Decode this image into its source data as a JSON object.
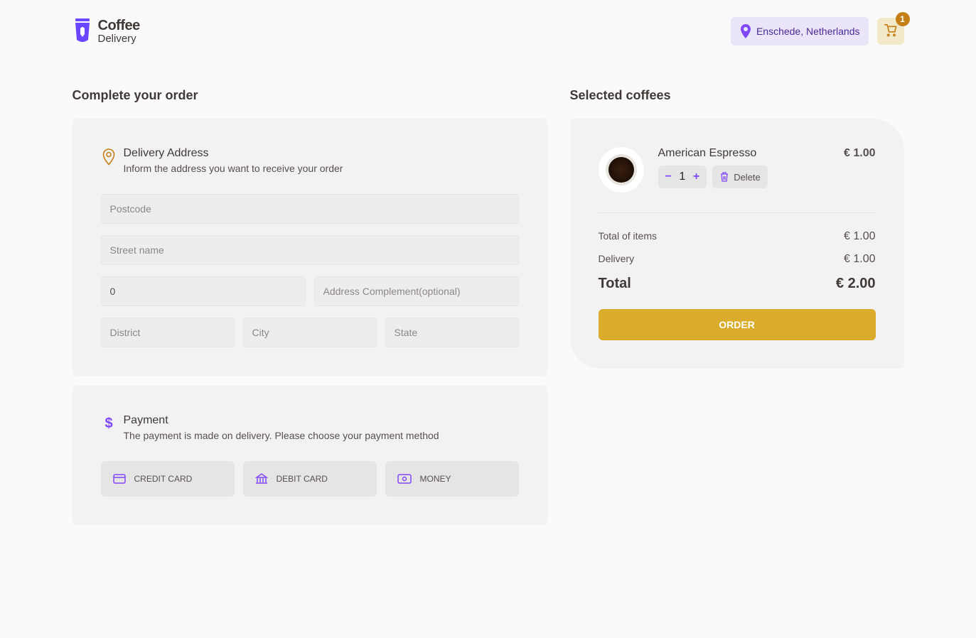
{
  "header": {
    "logo_line1": "Coffee",
    "logo_line2": "Delivery",
    "location": "Enschede, Netherlands",
    "cart_count": "1"
  },
  "checkout": {
    "title": "Complete your order",
    "address_card": {
      "title": "Delivery Address",
      "subtitle": "Inform the address you want to receive your order",
      "postcode_ph": "Postcode",
      "street_ph": "Street name",
      "number_value": "0",
      "complement_ph": "Address Complement(optional)",
      "district_ph": "District",
      "city_ph": "City",
      "state_ph": "State"
    },
    "payment_card": {
      "title": "Payment",
      "subtitle": "The payment is made on delivery. Please choose your payment method",
      "credit": "CREDIT CARD",
      "debit": "DEBIT CARD",
      "money": "MONEY"
    }
  },
  "cart": {
    "title": "Selected coffees",
    "item": {
      "name": "American Espresso",
      "qty": "1",
      "price": "€ 1.00",
      "delete_label": "Delete"
    },
    "totals": {
      "items_label": "Total of items",
      "items_value": "€ 1.00",
      "delivery_label": "Delivery",
      "delivery_value": "€ 1.00",
      "total_label": "Total",
      "total_value": "€ 2.00"
    },
    "order_label": "ORDER"
  }
}
